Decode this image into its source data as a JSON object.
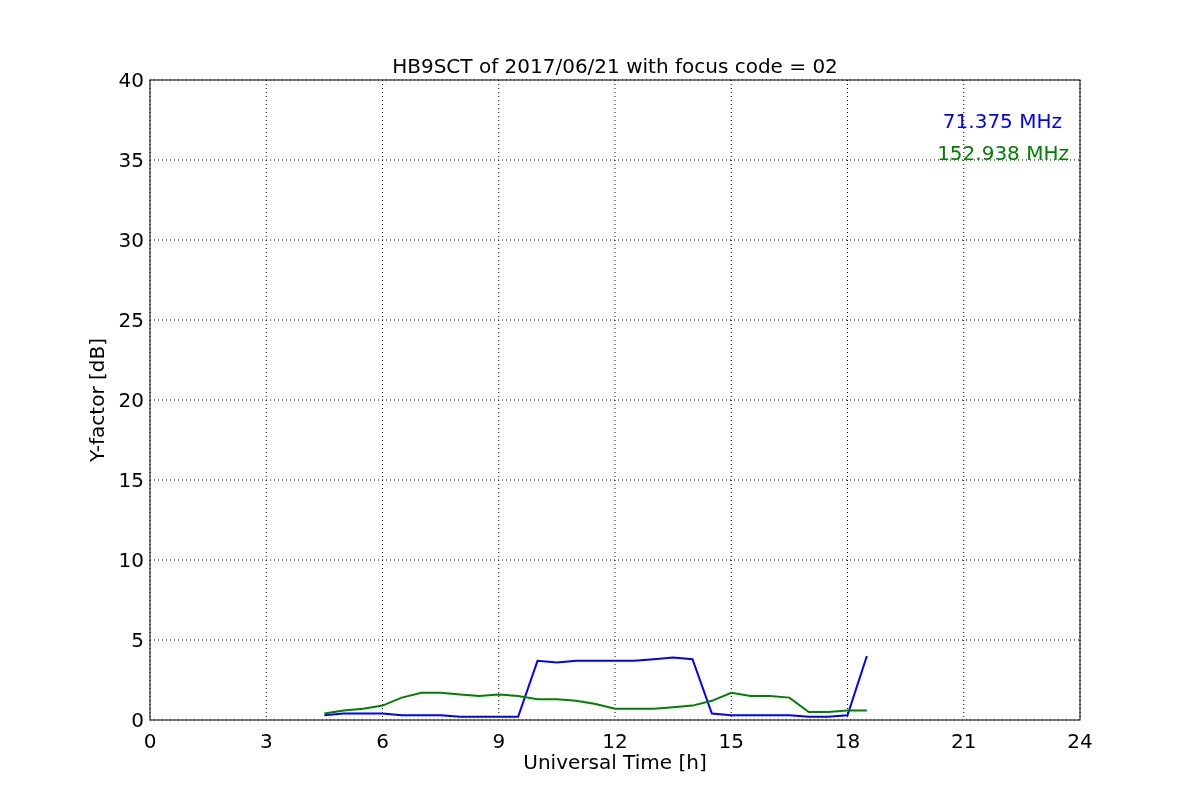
{
  "chart_data": {
    "type": "line",
    "title": "HB9SCT of 2017/06/21 with focus code = 02",
    "xlabel": "Universal Time [h]",
    "ylabel": "Y-factor [dB]",
    "x": [
      4.5,
      5,
      5.5,
      6,
      6.5,
      7,
      7.5,
      8,
      8.5,
      9,
      9.5,
      10,
      10.5,
      11,
      11.5,
      12,
      12.5,
      13,
      13.5,
      14,
      14.5,
      15,
      15.5,
      16,
      16.5,
      17,
      17.5,
      18,
      18.5
    ],
    "series": [
      {
        "name": "71.375 MHz",
        "color": "#0000ff",
        "values": [
          0.3,
          0.4,
          0.4,
          0.4,
          0.3,
          0.3,
          0.3,
          0.2,
          0.2,
          0.2,
          0.2,
          3.7,
          3.6,
          3.7,
          3.7,
          3.7,
          3.7,
          3.8,
          3.9,
          3.8,
          0.4,
          0.3,
          0.3,
          0.3,
          0.3,
          0.2,
          0.2,
          0.3,
          4.0
        ]
      },
      {
        "name": "152.938 MHz",
        "color": "#008000",
        "values": [
          0.4,
          0.6,
          0.7,
          0.9,
          1.4,
          1.7,
          1.7,
          1.6,
          1.5,
          1.6,
          1.5,
          1.3,
          1.3,
          1.2,
          1.0,
          0.7,
          0.7,
          0.7,
          0.8,
          0.9,
          1.2,
          1.7,
          1.5,
          1.5,
          1.4,
          0.5,
          0.5,
          0.6,
          0.6
        ]
      }
    ],
    "grid": true,
    "xlim": [
      0,
      24
    ],
    "ylim": [
      0,
      40
    ],
    "xticks": [
      0,
      3,
      6,
      9,
      12,
      15,
      18,
      21,
      24
    ],
    "yticks": [
      0,
      5,
      10,
      15,
      20,
      25,
      30,
      35,
      40
    ]
  }
}
